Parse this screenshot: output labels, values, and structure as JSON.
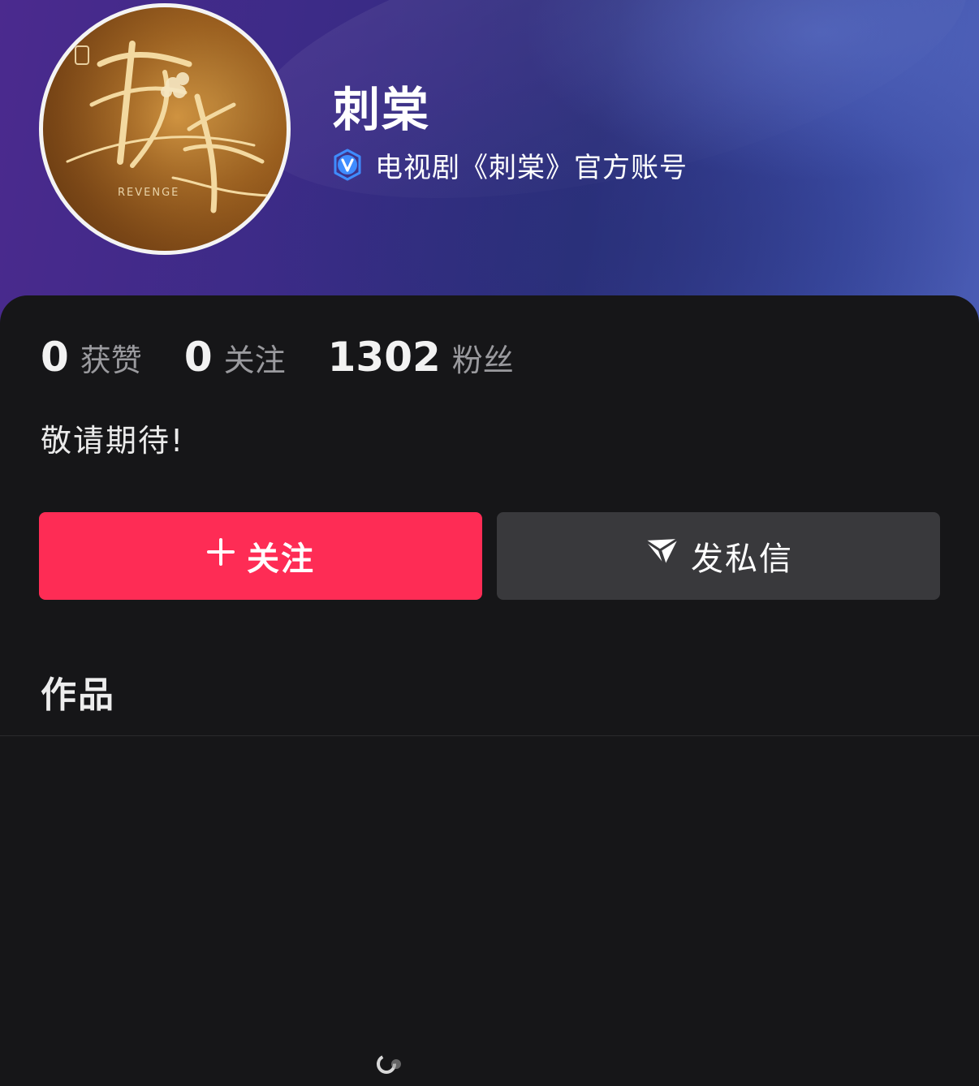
{
  "profile": {
    "name": "刺棠",
    "verification": "电视剧《刺棠》官方账号",
    "avatar_title_text": "REVENGE",
    "bio": "敬请期待!"
  },
  "stats": [
    {
      "count": "0",
      "label": "获赞"
    },
    {
      "count": "0",
      "label": "关注"
    },
    {
      "count": "1302",
      "label": "粉丝"
    }
  ],
  "actions": {
    "follow_label": "关注",
    "message_label": "发私信"
  },
  "section": {
    "works_title": "作品"
  },
  "colors": {
    "follow_button": "#fe2c55",
    "message_button": "#39393c",
    "verify_badge": "#3f8cff",
    "background": "#161618"
  },
  "icons": {
    "verify": "verified-v-icon",
    "plus": "plus-icon",
    "message": "paper-plane-icon"
  }
}
